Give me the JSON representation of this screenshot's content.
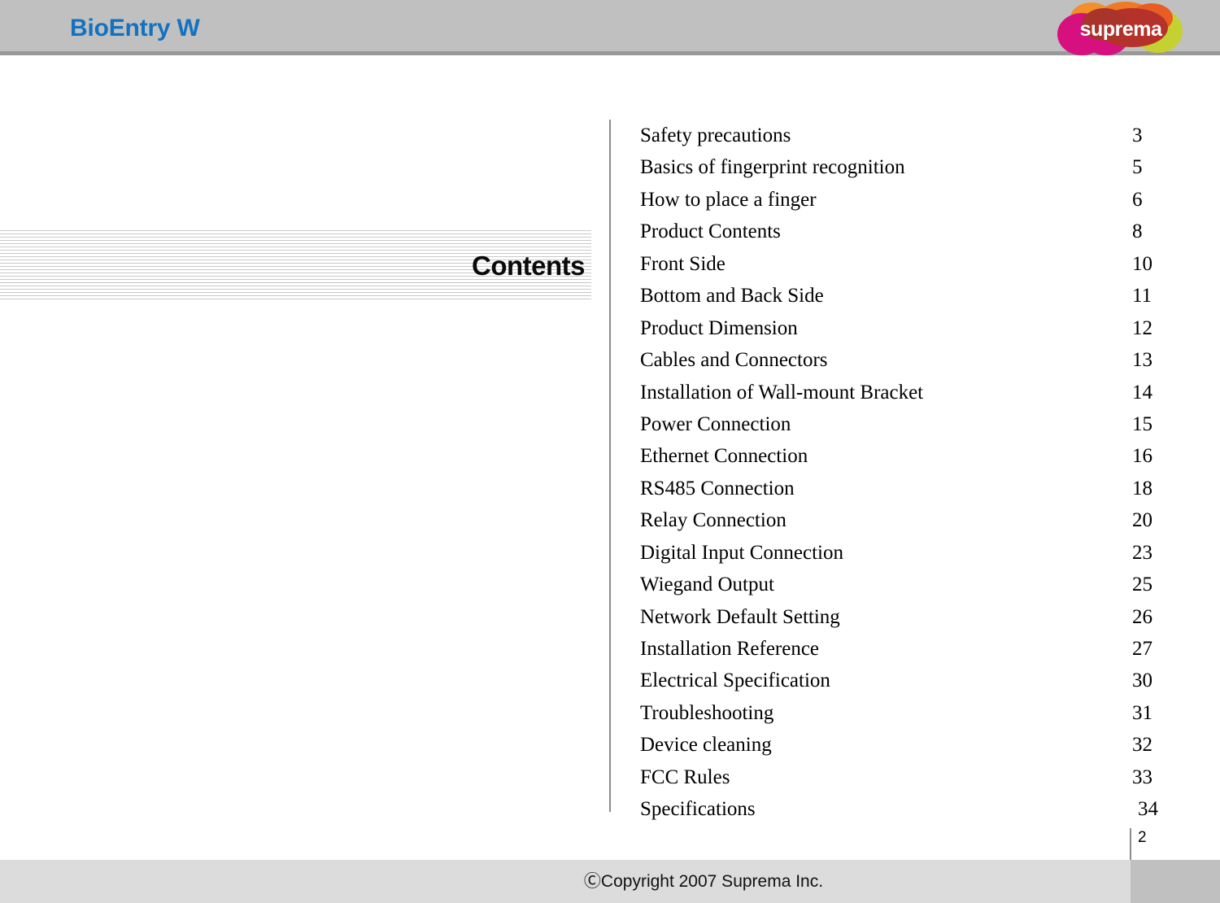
{
  "header": {
    "title": "BioEntry W",
    "logo_text": "suprema",
    "logo_colors": {
      "magenta": "#d6107f",
      "orange": "#f28f2a",
      "red": "#b93127",
      "yellow_green": "#c6d22a",
      "dark_red": "#a82a22"
    },
    "title_color": "#1372c0",
    "band_color": "#c0c0c0",
    "band_border_color": "#999999"
  },
  "contents": {
    "heading": "Contents",
    "items": [
      {
        "label": "Safety precautions",
        "page": "3"
      },
      {
        "label": "Basics of fingerprint recognition",
        "page": "5"
      },
      {
        "label": "How to place a finger",
        "page": "6"
      },
      {
        "label": "Product Contents",
        "page": "8"
      },
      {
        "label": "Front Side",
        "page": "10"
      },
      {
        "label": "Bottom and Back Side",
        "page": "11"
      },
      {
        "label": "Product Dimension",
        "page": "12"
      },
      {
        "label": "Cables and Connectors",
        "page": "13"
      },
      {
        "label": "Installation of Wall-mount Bracket",
        "page": "14"
      },
      {
        "label": "Power Connection",
        "page": "15"
      },
      {
        "label": "Ethernet Connection",
        "page": "16"
      },
      {
        "label": "RS485 Connection",
        "page": "18"
      },
      {
        "label": "Relay Connection",
        "page": "20"
      },
      {
        "label": "Digital Input Connection",
        "page": "23"
      },
      {
        "label": "Wiegand Output",
        "page": "25"
      },
      {
        "label": "Network Default Setting",
        "page": "26"
      },
      {
        "label": "Installation Reference",
        "page": "27"
      },
      {
        "label": "Electrical Specification",
        "page": "30"
      },
      {
        "label": "Troubleshooting",
        "page": "31"
      },
      {
        "label": "Device cleaning",
        "page": "32"
      },
      {
        "label": "FCC Rules",
        "page": "33"
      },
      {
        "label": "Specifications",
        "page": "34"
      }
    ]
  },
  "footer": {
    "copyright": "ⒸCopyright 2007 Suprema Inc.",
    "page_number": "2",
    "band_color": "#dcdcdc",
    "band_dark_color": "#c0c0c0"
  }
}
